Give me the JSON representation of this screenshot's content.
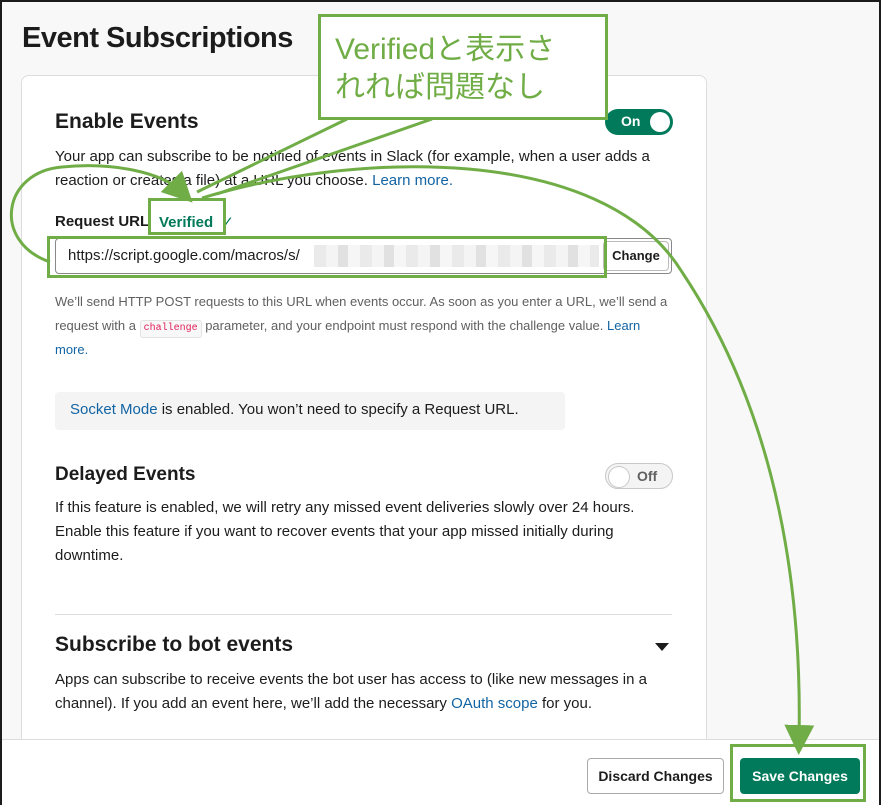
{
  "page": {
    "title": "Event Subscriptions"
  },
  "enable_events": {
    "title": "Enable Events",
    "toggle_label": "On",
    "description_pre": "Your app can subscribe to be notified of events in Slack (for example, when a user adds a reaction or creates a file) at a URL you choose.",
    "learn_more": "Learn more.",
    "request_url_label": "Request URL",
    "verified_label": "Verified",
    "verified_check": "✓",
    "url_value": "https://script.google.com/macros/s/",
    "change_button": "Change",
    "help_pre": "We’ll send HTTP POST requests to this URL when events occur. As soon as you enter a URL, we’ll send a request with a",
    "help_code": "challenge",
    "help_post": "parameter, and your endpoint must respond with the challenge value.",
    "help_learn_more": "Learn more."
  },
  "socket_mode": {
    "link_text": "Socket Mode",
    "text": "is enabled. You won’t need to specify a Request URL."
  },
  "delayed_events": {
    "title": "Delayed Events",
    "toggle_label": "Off",
    "description": "If this feature is enabled, we will retry any missed event deliveries slowly over 24 hours. Enable this feature if you want to recover events that your app missed initially during downtime."
  },
  "bot_events": {
    "title": "Subscribe to bot events",
    "description_pre": "Apps can subscribe to receive events the bot user has access to (like new messages in a channel). If you add an event here, we’ll add the necessary",
    "oauth_link": "OAuth scope",
    "description_post": "for you."
  },
  "footer": {
    "discard_button": "Discard Changes",
    "save_button": "Save Changes"
  },
  "annotation": {
    "line1": "Verifiedと表示さ",
    "line2": "れれば問題なし"
  },
  "colors": {
    "accent_green": "#007a5a",
    "annotation_green": "#70ad47",
    "link_blue": "#1264a3"
  }
}
